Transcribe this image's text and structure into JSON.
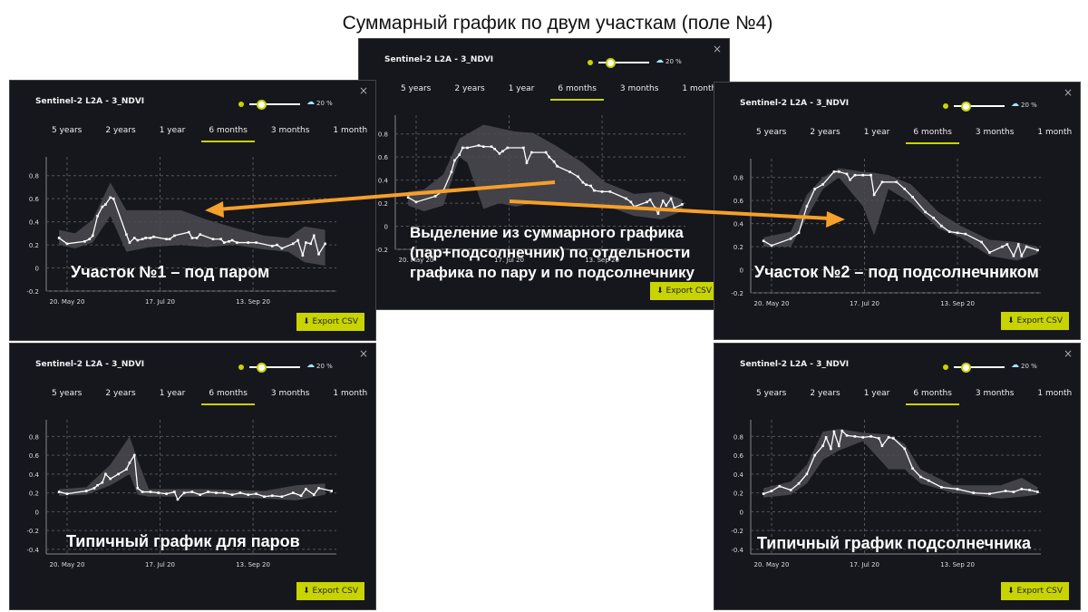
{
  "slide_title": "Суммарный график по двум участкам (поле №4)",
  "common": {
    "panel_title": "Sentinel-2 L2A - 3_NDVI",
    "cloud_pct": "20 %",
    "cloud_slider_value_pct": 20,
    "tabs": [
      "5 years",
      "2 years",
      "1 year",
      "6 months",
      "3 months",
      "1 month"
    ],
    "active_tab": "6 months",
    "export_label": "Export CSV",
    "close_label": "×",
    "x_ticks": [
      [
        "2020-05-20",
        "20. May 20"
      ],
      [
        "2020-07-17",
        "17. Jul 20"
      ],
      [
        "2020-09-13",
        "13. Sep 20"
      ]
    ],
    "colors": {
      "accent": "#c8d400",
      "background": "#16161d",
      "line": "#ffffff",
      "band": "#4a4a50",
      "arrow": "#f5a02a"
    }
  },
  "annotations": {
    "plot1": "Участок №1 – под паром",
    "plot2": "Участок №2 – под подсолнечником",
    "center_lines": [
      "Выделение из суммарного графика",
      "(пар+подсолнечник) по отдельности",
      "графика по пару и по подсолнечнику"
    ],
    "plot4": "Типичный график для паров",
    "plot5": "Типичный график  подсолнечника"
  },
  "chart_data": [
    {
      "id": "plot1",
      "type": "line",
      "title": "Sentinel-2 L2A - 3_NDVI",
      "xlim": [
        "2020-05-07",
        "2020-11-04"
      ],
      "ylim": [
        -0.2,
        0.9
      ],
      "y_ticks": [
        -0.2,
        0,
        0.2,
        0.4,
        0.6,
        0.8
      ],
      "grid": true,
      "points": [
        [
          "2020-05-15",
          0.26
        ],
        [
          "2020-05-20",
          0.21
        ],
        [
          "2020-05-31",
          0.23
        ],
        [
          "2020-06-03",
          0.25
        ],
        [
          "2020-06-05",
          0.28
        ],
        [
          "2020-06-08",
          0.45
        ],
        [
          "2020-06-11",
          0.53
        ],
        [
          "2020-06-13",
          0.55
        ],
        [
          "2020-06-16",
          0.61
        ],
        [
          "2020-06-18",
          0.6
        ],
        [
          "2020-06-26",
          0.29
        ],
        [
          "2020-06-28",
          0.22
        ],
        [
          "2020-07-01",
          0.26
        ],
        [
          "2020-07-03",
          0.24
        ],
        [
          "2020-07-06",
          0.25
        ],
        [
          "2020-07-08",
          0.26
        ],
        [
          "2020-07-11",
          0.26
        ],
        [
          "2020-07-13",
          0.27
        ],
        [
          "2020-07-21",
          0.25
        ],
        [
          "2020-07-23",
          0.25
        ],
        [
          "2020-07-26",
          0.28
        ],
        [
          "2020-08-04",
          0.31
        ],
        [
          "2020-08-06",
          0.26
        ],
        [
          "2020-08-09",
          0.26
        ],
        [
          "2020-08-11",
          0.29
        ],
        [
          "2020-08-19",
          0.25
        ],
        [
          "2020-08-24",
          0.25
        ],
        [
          "2020-08-26",
          0.22
        ],
        [
          "2020-08-29",
          0.23
        ],
        [
          "2020-08-31",
          0.24
        ],
        [
          "2020-09-03",
          0.22
        ],
        [
          "2020-09-10",
          0.22
        ],
        [
          "2020-09-15",
          0.22
        ],
        [
          "2020-09-25",
          0.19
        ],
        [
          "2020-09-28",
          0.2
        ],
        [
          "2020-10-01",
          0.17
        ],
        [
          "2020-10-08",
          0.21
        ],
        [
          "2020-10-11",
          0.24
        ],
        [
          "2020-10-14",
          0.11
        ],
        [
          "2020-10-16",
          0.22
        ],
        [
          "2020-10-19",
          0.21
        ],
        [
          "2020-10-21",
          0.28
        ],
        [
          "2020-10-24",
          0.12
        ],
        [
          "2020-10-28",
          0.21
        ]
      ],
      "band": [
        [
          "2020-05-15",
          0.2,
          0.33
        ],
        [
          "2020-05-25",
          0.17,
          0.3
        ],
        [
          "2020-06-05",
          0.22,
          0.42
        ],
        [
          "2020-06-16",
          0.45,
          0.74
        ],
        [
          "2020-06-26",
          0.14,
          0.5
        ],
        [
          "2020-07-10",
          0.18,
          0.5
        ],
        [
          "2020-07-30",
          0.2,
          0.5
        ],
        [
          "2020-08-15",
          0.18,
          0.42
        ],
        [
          "2020-09-01",
          0.2,
          0.35
        ],
        [
          "2020-09-20",
          0.16,
          0.28
        ],
        [
          "2020-10-05",
          0.14,
          0.26
        ],
        [
          "2020-10-15",
          0.05,
          0.36
        ],
        [
          "2020-10-28",
          0.02,
          0.33
        ]
      ]
    },
    {
      "id": "plot_sum",
      "type": "line",
      "title": "Sentinel-2 L2A - 3_NDVI",
      "xlim": [
        "2020-05-07",
        "2020-11-04"
      ],
      "ylim": [
        -0.2,
        0.9
      ],
      "y_ticks": [
        -0.2,
        0,
        0.2,
        0.4,
        0.6,
        0.8
      ],
      "grid": true,
      "points": [
        [
          "2020-05-15",
          0.25
        ],
        [
          "2020-05-20",
          0.21
        ],
        [
          "2020-06-01",
          0.26
        ],
        [
          "2020-06-06",
          0.31
        ],
        [
          "2020-06-11",
          0.47
        ],
        [
          "2020-06-13",
          0.57
        ],
        [
          "2020-06-16",
          0.62
        ],
        [
          "2020-06-18",
          0.68
        ],
        [
          "2020-06-21",
          0.68
        ],
        [
          "2020-06-28",
          0.7
        ],
        [
          "2020-07-01",
          0.69
        ],
        [
          "2020-07-06",
          0.69
        ],
        [
          "2020-07-08",
          0.67
        ],
        [
          "2020-07-11",
          0.63
        ],
        [
          "2020-07-13",
          0.65
        ],
        [
          "2020-07-16",
          0.68
        ],
        [
          "2020-07-26",
          0.68
        ],
        [
          "2020-07-28",
          0.55
        ],
        [
          "2020-07-31",
          0.64
        ],
        [
          "2020-08-09",
          0.64
        ],
        [
          "2020-08-11",
          0.6
        ],
        [
          "2020-08-14",
          0.56
        ],
        [
          "2020-08-16",
          0.52
        ],
        [
          "2020-08-24",
          0.47
        ],
        [
          "2020-08-29",
          0.43
        ],
        [
          "2020-09-01",
          0.38
        ],
        [
          "2020-09-03",
          0.36
        ],
        [
          "2020-09-06",
          0.35
        ],
        [
          "2020-09-08",
          0.31
        ],
        [
          "2020-09-13",
          0.3
        ],
        [
          "2020-09-18",
          0.3
        ],
        [
          "2020-09-28",
          0.24
        ],
        [
          "2020-10-01",
          0.21
        ],
        [
          "2020-10-03",
          0.17
        ],
        [
          "2020-10-11",
          0.21
        ],
        [
          "2020-10-13",
          0.23
        ],
        [
          "2020-10-16",
          0.16
        ],
        [
          "2020-10-18",
          0.11
        ],
        [
          "2020-10-21",
          0.22
        ],
        [
          "2020-10-23",
          0.18
        ],
        [
          "2020-10-26",
          0.24
        ],
        [
          "2020-10-28",
          0.16
        ],
        [
          "2020-11-02",
          0.19
        ]
      ],
      "band": [
        [
          "2020-05-15",
          0.18,
          0.3
        ],
        [
          "2020-05-25",
          0.13,
          0.32
        ],
        [
          "2020-06-06",
          0.18,
          0.45
        ],
        [
          "2020-06-16",
          0.6,
          0.76
        ],
        [
          "2020-06-21",
          0.55,
          0.8
        ],
        [
          "2020-07-01",
          0.15,
          0.88
        ],
        [
          "2020-07-11",
          0.2,
          0.85
        ],
        [
          "2020-07-21",
          0.17,
          0.82
        ],
        [
          "2020-08-01",
          0.2,
          0.81
        ],
        [
          "2020-08-15",
          0.2,
          0.7
        ],
        [
          "2020-09-01",
          0.18,
          0.55
        ],
        [
          "2020-09-15",
          0.18,
          0.38
        ],
        [
          "2020-10-03",
          0.09,
          0.28
        ],
        [
          "2020-10-20",
          0.06,
          0.3
        ],
        [
          "2020-11-02",
          0.13,
          0.23
        ]
      ]
    },
    {
      "id": "plot2",
      "type": "line",
      "title": "Sentinel-2 L2A - 3_NDVI",
      "xlim": [
        "2020-05-07",
        "2020-11-04"
      ],
      "ylim": [
        -0.2,
        0.9
      ],
      "y_ticks": [
        -0.2,
        0,
        0.2,
        0.4,
        0.6,
        0.8
      ],
      "grid": true,
      "points": [
        [
          "2020-05-15",
          0.25
        ],
        [
          "2020-05-20",
          0.21
        ],
        [
          "2020-06-01",
          0.27
        ],
        [
          "2020-06-06",
          0.32
        ],
        [
          "2020-06-11",
          0.55
        ],
        [
          "2020-06-16",
          0.7
        ],
        [
          "2020-06-21",
          0.74
        ],
        [
          "2020-06-28",
          0.85
        ],
        [
          "2020-07-01",
          0.85
        ],
        [
          "2020-07-06",
          0.83
        ],
        [
          "2020-07-08",
          0.78
        ],
        [
          "2020-07-11",
          0.82
        ],
        [
          "2020-07-16",
          0.82
        ],
        [
          "2020-07-21",
          0.82
        ],
        [
          "2020-07-23",
          0.65
        ],
        [
          "2020-07-28",
          0.76
        ],
        [
          "2020-08-06",
          0.76
        ],
        [
          "2020-08-11",
          0.7
        ],
        [
          "2020-08-16",
          0.63
        ],
        [
          "2020-08-24",
          0.5
        ],
        [
          "2020-08-29",
          0.45
        ],
        [
          "2020-09-03",
          0.38
        ],
        [
          "2020-09-08",
          0.33
        ],
        [
          "2020-09-13",
          0.32
        ],
        [
          "2020-09-18",
          0.31
        ],
        [
          "2020-09-28",
          0.24
        ],
        [
          "2020-10-03",
          0.15
        ],
        [
          "2020-10-11",
          0.2
        ],
        [
          "2020-10-14",
          0.22
        ],
        [
          "2020-10-18",
          0.12
        ],
        [
          "2020-10-21",
          0.22
        ],
        [
          "2020-10-23",
          0.12
        ],
        [
          "2020-10-26",
          0.2
        ],
        [
          "2020-11-02",
          0.17
        ]
      ],
      "band": [
        [
          "2020-05-15",
          0.2,
          0.28
        ],
        [
          "2020-06-01",
          0.2,
          0.33
        ],
        [
          "2020-06-11",
          0.45,
          0.65
        ],
        [
          "2020-06-21",
          0.7,
          0.8
        ],
        [
          "2020-07-01",
          0.8,
          0.88
        ],
        [
          "2020-07-16",
          0.55,
          0.85
        ],
        [
          "2020-07-23",
          0.3,
          0.84
        ],
        [
          "2020-08-01",
          0.7,
          0.82
        ],
        [
          "2020-08-15",
          0.58,
          0.74
        ],
        [
          "2020-09-01",
          0.36,
          0.5
        ],
        [
          "2020-09-15",
          0.28,
          0.38
        ],
        [
          "2020-10-03",
          0.12,
          0.26
        ],
        [
          "2020-10-20",
          0.08,
          0.24
        ],
        [
          "2020-11-02",
          0.14,
          0.2
        ]
      ]
    },
    {
      "id": "plot4",
      "type": "line",
      "title": "Sentinel-2 L2A - 3_NDVI",
      "xlim": [
        "2020-05-07",
        "2020-11-04"
      ],
      "ylim": [
        -0.45,
        0.9
      ],
      "y_ticks": [
        -0.4,
        -0.2,
        0,
        0.2,
        0.4,
        0.6,
        0.8
      ],
      "grid": true,
      "points": [
        [
          "2020-05-15",
          0.21
        ],
        [
          "2020-05-20",
          0.19
        ],
        [
          "2020-06-01",
          0.22
        ],
        [
          "2020-06-06",
          0.25
        ],
        [
          "2020-06-08",
          0.28
        ],
        [
          "2020-06-11",
          0.31
        ],
        [
          "2020-06-13",
          0.4
        ],
        [
          "2020-06-16",
          0.35
        ],
        [
          "2020-06-21",
          0.4
        ],
        [
          "2020-06-26",
          0.45
        ],
        [
          "2020-06-28",
          0.52
        ],
        [
          "2020-07-01",
          0.6
        ],
        [
          "2020-07-03",
          0.25
        ],
        [
          "2020-07-06",
          0.21
        ],
        [
          "2020-07-11",
          0.21
        ],
        [
          "2020-07-16",
          0.2
        ],
        [
          "2020-07-21",
          0.19
        ],
        [
          "2020-07-26",
          0.21
        ],
        [
          "2020-07-28",
          0.13
        ],
        [
          "2020-08-01",
          0.2
        ],
        [
          "2020-08-06",
          0.21
        ],
        [
          "2020-08-11",
          0.18
        ],
        [
          "2020-08-16",
          0.21
        ],
        [
          "2020-08-21",
          0.2
        ],
        [
          "2020-08-26",
          0.2
        ],
        [
          "2020-08-31",
          0.18
        ],
        [
          "2020-09-05",
          0.2
        ],
        [
          "2020-09-10",
          0.18
        ],
        [
          "2020-09-15",
          0.19
        ],
        [
          "2020-09-20",
          0.16
        ],
        [
          "2020-09-25",
          0.17
        ],
        [
          "2020-10-01",
          0.16
        ],
        [
          "2020-10-08",
          0.2
        ],
        [
          "2020-10-13",
          0.17
        ],
        [
          "2020-10-16",
          0.24
        ],
        [
          "2020-10-21",
          0.18
        ],
        [
          "2020-10-24",
          0.25
        ],
        [
          "2020-11-01",
          0.22
        ]
      ],
      "band": [
        [
          "2020-05-15",
          0.17,
          0.24
        ],
        [
          "2020-06-01",
          0.18,
          0.26
        ],
        [
          "2020-06-16",
          0.28,
          0.5
        ],
        [
          "2020-06-28",
          0.4,
          0.8
        ],
        [
          "2020-07-03",
          0.18,
          0.55
        ],
        [
          "2020-07-10",
          0.16,
          0.24
        ],
        [
          "2020-08-15",
          0.16,
          0.24
        ],
        [
          "2020-09-20",
          0.14,
          0.22
        ],
        [
          "2020-10-10",
          0.12,
          0.28
        ],
        [
          "2020-10-28",
          0.18,
          0.3
        ]
      ]
    },
    {
      "id": "plot5",
      "type": "line",
      "title": "Sentinel-2 L2A - 3_NDVI",
      "xlim": [
        "2020-05-07",
        "2020-11-04"
      ],
      "ylim": [
        -0.45,
        0.9
      ],
      "y_ticks": [
        -0.4,
        -0.2,
        0,
        0.2,
        0.4,
        0.6,
        0.8
      ],
      "grid": true,
      "points": [
        [
          "2020-05-15",
          0.19
        ],
        [
          "2020-05-20",
          0.22
        ],
        [
          "2020-05-25",
          0.27
        ],
        [
          "2020-06-01",
          0.23
        ],
        [
          "2020-06-06",
          0.3
        ],
        [
          "2020-06-11",
          0.4
        ],
        [
          "2020-06-16",
          0.6
        ],
        [
          "2020-06-21",
          0.7
        ],
        [
          "2020-06-23",
          0.79
        ],
        [
          "2020-06-26",
          0.67
        ],
        [
          "2020-06-28",
          0.85
        ],
        [
          "2020-07-01",
          0.7
        ],
        [
          "2020-07-03",
          0.86
        ],
        [
          "2020-07-06",
          0.81
        ],
        [
          "2020-07-11",
          0.8
        ],
        [
          "2020-07-16",
          0.79
        ],
        [
          "2020-07-21",
          0.8
        ],
        [
          "2020-07-26",
          0.78
        ],
        [
          "2020-07-28",
          0.7
        ],
        [
          "2020-08-01",
          0.79
        ],
        [
          "2020-08-04",
          0.78
        ],
        [
          "2020-08-11",
          0.67
        ],
        [
          "2020-08-16",
          0.46
        ],
        [
          "2020-08-21",
          0.37
        ],
        [
          "2020-08-26",
          0.33
        ],
        [
          "2020-09-03",
          0.26
        ],
        [
          "2020-09-13",
          0.24
        ],
        [
          "2020-09-23",
          0.2
        ],
        [
          "2020-10-03",
          0.19
        ],
        [
          "2020-10-13",
          0.22
        ],
        [
          "2020-10-18",
          0.21
        ],
        [
          "2020-10-23",
          0.24
        ],
        [
          "2020-10-28",
          0.23
        ],
        [
          "2020-11-02",
          0.21
        ]
      ],
      "band": [
        [
          "2020-05-15",
          0.15,
          0.25
        ],
        [
          "2020-06-01",
          0.18,
          0.32
        ],
        [
          "2020-06-11",
          0.3,
          0.5
        ],
        [
          "2020-06-21",
          0.55,
          0.85
        ],
        [
          "2020-07-01",
          0.65,
          0.88
        ],
        [
          "2020-07-16",
          0.75,
          0.84
        ],
        [
          "2020-08-01",
          0.45,
          0.82
        ],
        [
          "2020-08-11",
          0.45,
          0.72
        ],
        [
          "2020-08-21",
          0.3,
          0.45
        ],
        [
          "2020-09-10",
          0.2,
          0.28
        ],
        [
          "2020-10-10",
          0.14,
          0.28
        ],
        [
          "2020-10-23",
          0.16,
          0.36
        ],
        [
          "2020-11-02",
          0.18,
          0.26
        ]
      ]
    }
  ]
}
